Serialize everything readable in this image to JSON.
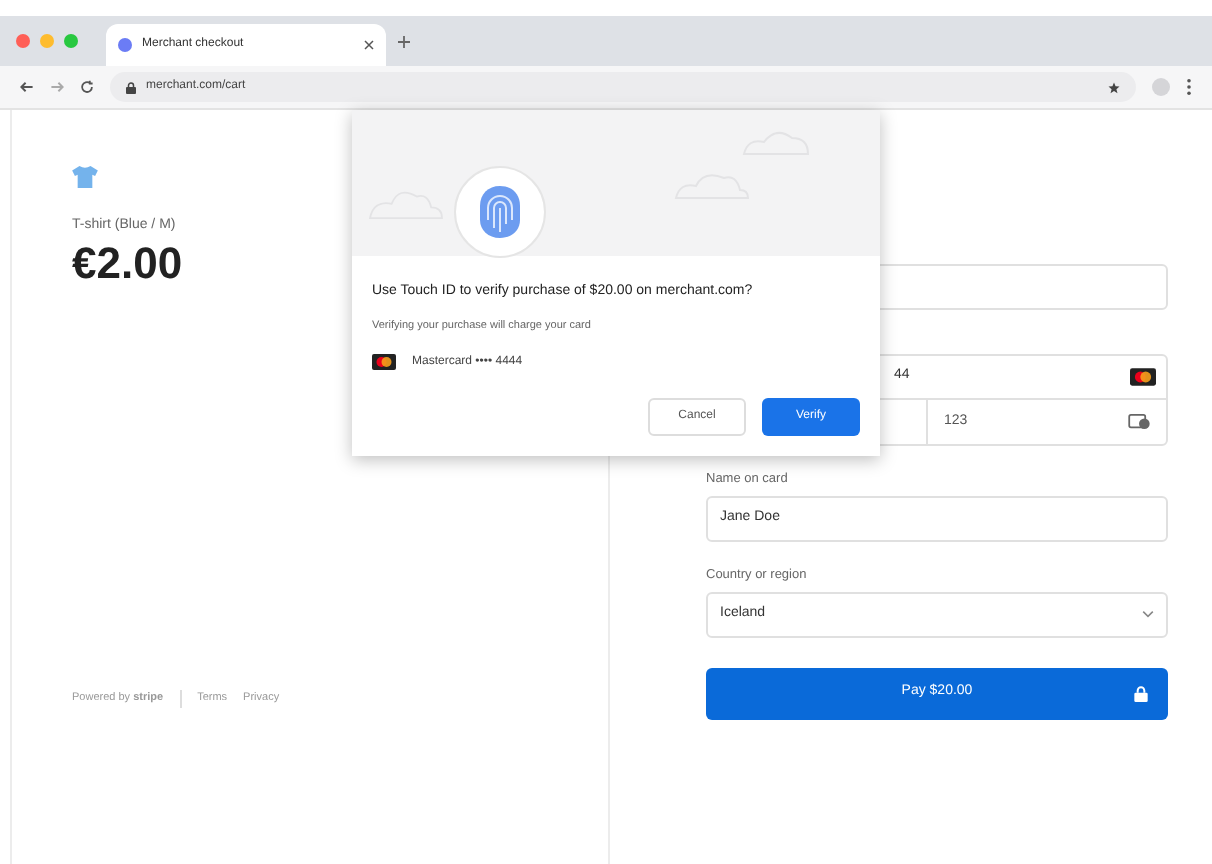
{
  "browser": {
    "tab_title": "Merchant checkout",
    "url": "merchant.com/cart"
  },
  "summary": {
    "product": "T-shirt (Blue / M)",
    "price": "€2.00"
  },
  "footer": {
    "powered_by": "Powered by **stripe**",
    "links": [
      "Terms",
      "Privacy"
    ]
  },
  "form": {
    "card_number_visible": "44",
    "cvc": "123",
    "name_label": "Name on card",
    "name_value": "Jane Doe",
    "country_label": "Country or region",
    "country_value": "Iceland",
    "pay_button": "Pay $20.00"
  },
  "dialog": {
    "title": "Use Touch ID to verify purchase of $20.00 on merchant.com?",
    "subtitle": "Verifying your purchase will charge your card",
    "card": "Mastercard •••• 4444",
    "buttons": [
      {
        "label": "Cancel",
        "kind": "secondary"
      },
      {
        "label": "Verify",
        "kind": "primary"
      }
    ]
  }
}
